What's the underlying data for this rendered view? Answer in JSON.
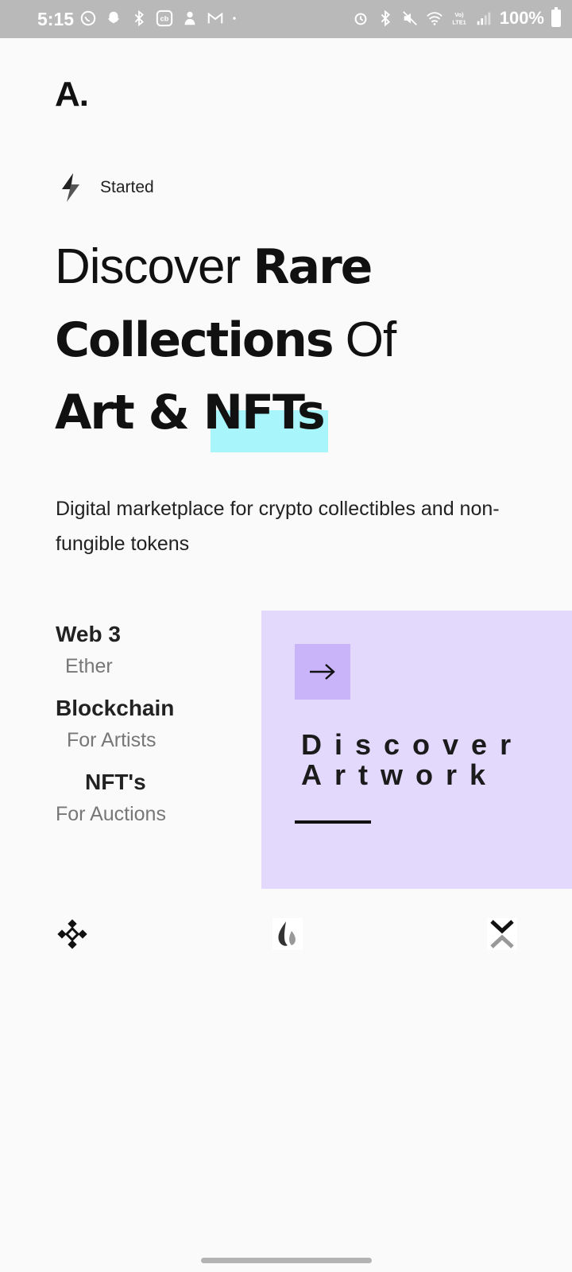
{
  "status_bar": {
    "time": "5:15",
    "battery": "100%",
    "left_icons": [
      "whatsapp-icon",
      "snapchat-icon",
      "bluetooth-icon",
      "coinbase-icon",
      "app-icon",
      "gmail-icon",
      "dot-icon"
    ],
    "right_icons": [
      "alarm-icon",
      "bluetooth-icon",
      "mute-icon",
      "wifi-icon",
      "volte-icon",
      "signal-icon",
      "battery-icon"
    ]
  },
  "logo": "A.",
  "started": {
    "label": "Started",
    "icon": "bolt-icon"
  },
  "headline": {
    "line1_light": "Discover ",
    "line1_bold": "Rare",
    "line2_bold": "Collections",
    "line2_light": " Of",
    "line3_bold": "Art & NFTs",
    "highlight_color": "#a8f6fb"
  },
  "subtitle": "Digital marketplace for crypto collectibles and non-fungible tokens",
  "stats": [
    {
      "title": "Web 3",
      "sub": "Ether"
    },
    {
      "title": "Blockchain",
      "sub": "For Artists"
    },
    {
      "title": "NFT's",
      "sub": "For Auctions"
    }
  ],
  "card": {
    "title_line1": "Discover",
    "title_line2": "Artwork",
    "icon": "arrow-right-icon",
    "bg_color": "#e3d9fc",
    "accent_color": "#c9b4fa"
  },
  "partners": [
    "binance-icon",
    "flame-drop-icon",
    "x-chevron-icon"
  ]
}
